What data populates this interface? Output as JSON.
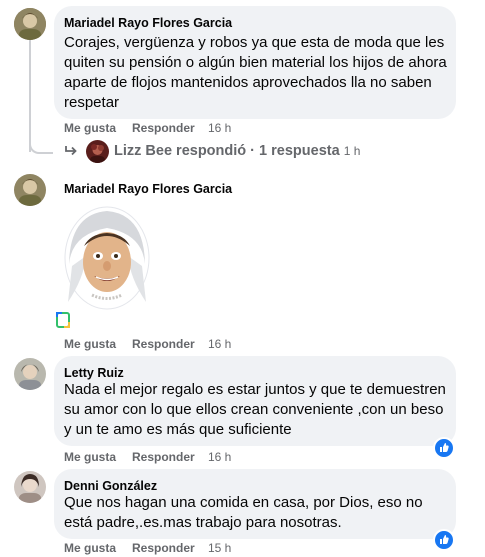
{
  "comments": [
    {
      "author": "Mariadel Rayo Flores Garcia",
      "text": "Corajes, vergüenza y robos ya que esta de moda que les quiten su pensión o algún bien material los hijos de ahora aparte de flojos mantenidos aprovechados lla no saben respetar",
      "like_label": "Me gusta",
      "reply_label": "Responder",
      "time": "16 h",
      "reply_summary": {
        "replier": "Lizz Bee",
        "action": "respondió",
        "separator": "·",
        "count_label": "1 respuesta",
        "time": "1 h"
      }
    },
    {
      "author": "Mariadel Rayo Flores Garcia",
      "text": "",
      "attachment": "sticker-image",
      "like_label": "Me gusta",
      "reply_label": "Responder",
      "time": "16 h"
    },
    {
      "author": "Letty Ruiz",
      "text": "Nada el mejor regalo es estar juntos y que te demuestren su amor con lo que ellos crean conveniente ,con un beso y un te amo es más que suficiente",
      "like_label": "Me gusta",
      "reply_label": "Responder",
      "time": "16 h",
      "reaction": "like-icon"
    },
    {
      "author": "Denni González",
      "text": "Que nos hagan una comida en casa, por Dios, eso no está padre,.es.mas trabajo para nosotras.",
      "like_label": "Me gusta",
      "reply_label": "Responder",
      "time": "15 h",
      "reaction": "like-icon"
    }
  ],
  "colors": {
    "bubble": "#f0f2f5",
    "meta_text": "#65676b",
    "like_blue": "#1877f2",
    "thread_line": "#ced0d4"
  }
}
